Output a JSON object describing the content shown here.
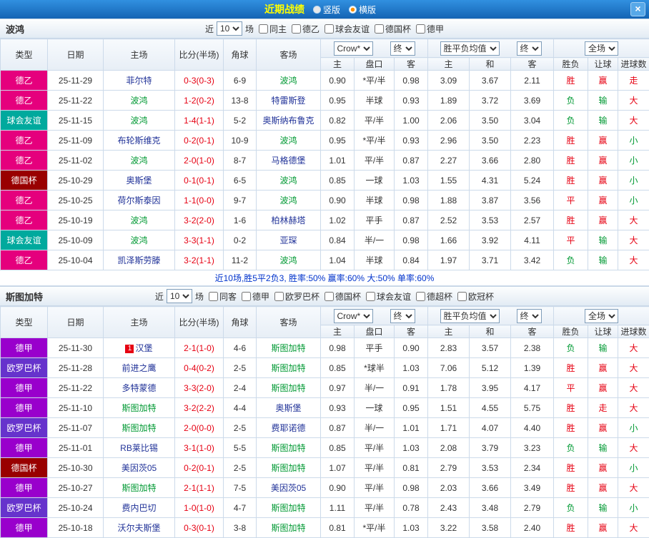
{
  "titlebar": {
    "title": "近期战绩",
    "radio_vertical": "竖版",
    "radio_horizontal": "横版",
    "close_label": "×"
  },
  "controls": {
    "near_label": "近",
    "match_count": "10",
    "games_label": "场",
    "bookmaker": "Crow*",
    "final_label": "终",
    "avg_label": "胜平负均值",
    "scope_label": "全场"
  },
  "columns": {
    "type": "类型",
    "date": "日期",
    "home": "主场",
    "score": "比分(半场)",
    "corners": "角球",
    "away": "客场",
    "odds_home": "主",
    "handicap": "盘口",
    "odds_away": "客",
    "avg_win": "主",
    "avg_draw": "和",
    "avg_lose": "客",
    "result": "胜负",
    "handicap_result": "让球",
    "goals": "进球数"
  },
  "colors": {
    "types": {
      "德乙": "#e5007d",
      "球会友谊": "#00a99d",
      "德国杯": "#990000",
      "德甲": "#9900cc",
      "欧罗巴杯": "#6633cc"
    },
    "focal_team": "#009933",
    "opponent_team": "#203298",
    "score_red": "#e60012",
    "win_red": "#e60012",
    "lose_green": "#009933"
  },
  "teams": [
    {
      "name": "波鸿",
      "checkboxes": [
        "同主",
        "德乙",
        "球会友谊",
        "德国杯",
        "德甲"
      ],
      "summary": "近10场,胜5平2负3, 胜率:50% 赢率:60% 大:50% 单率:60%",
      "matches": [
        {
          "type": "德乙",
          "date": "25-11-29",
          "home": "菲尔特",
          "home_focal": false,
          "score": "0-3(0-3)",
          "corners": "6-9",
          "away": "波鸿",
          "away_focal": true,
          "odds_home": "0.90",
          "handicap": "*平/半",
          "odds_away": "0.98",
          "avg_win": "3.09",
          "avg_draw": "3.67",
          "avg_lose": "2.11",
          "result": "胜",
          "result_color": "red",
          "handicap_result": "赢",
          "handicap_result_color": "red",
          "goals": "走",
          "goals_color": "red"
        },
        {
          "type": "德乙",
          "date": "25-11-22",
          "home": "波鸿",
          "home_focal": true,
          "score": "1-2(0-2)",
          "corners": "13-8",
          "away": "特雷斯登",
          "away_focal": false,
          "odds_home": "0.95",
          "handicap": "半球",
          "odds_away": "0.93",
          "avg_win": "1.89",
          "avg_draw": "3.72",
          "avg_lose": "3.69",
          "result": "负",
          "result_color": "green",
          "handicap_result": "输",
          "handicap_result_color": "green",
          "goals": "大",
          "goals_color": "red"
        },
        {
          "type": "球会友谊",
          "date": "25-11-15",
          "home": "波鸿",
          "home_focal": true,
          "score": "1-4(1-1)",
          "corners": "5-2",
          "away": "奥斯纳布鲁克",
          "away_focal": false,
          "odds_home": "0.82",
          "handicap": "平/半",
          "odds_away": "1.00",
          "avg_win": "2.06",
          "avg_draw": "3.50",
          "avg_lose": "3.04",
          "result": "负",
          "result_color": "green",
          "handicap_result": "输",
          "handicap_result_color": "green",
          "goals": "大",
          "goals_color": "red"
        },
        {
          "type": "德乙",
          "date": "25-11-09",
          "home": "布轮斯维克",
          "home_focal": false,
          "score": "0-2(0-1)",
          "corners": "10-9",
          "away": "波鸿",
          "away_focal": true,
          "odds_home": "0.95",
          "handicap": "*平/半",
          "odds_away": "0.93",
          "avg_win": "2.96",
          "avg_draw": "3.50",
          "avg_lose": "2.23",
          "result": "胜",
          "result_color": "red",
          "handicap_result": "赢",
          "handicap_result_color": "red",
          "goals": "小",
          "goals_color": "green"
        },
        {
          "type": "德乙",
          "date": "25-11-02",
          "home": "波鸿",
          "home_focal": true,
          "score": "2-0(1-0)",
          "corners": "8-7",
          "away": "马格德堡",
          "away_focal": false,
          "odds_home": "1.01",
          "handicap": "平/半",
          "odds_away": "0.87",
          "avg_win": "2.27",
          "avg_draw": "3.66",
          "avg_lose": "2.80",
          "result": "胜",
          "result_color": "red",
          "handicap_result": "赢",
          "handicap_result_color": "red",
          "goals": "小",
          "goals_color": "green"
        },
        {
          "type": "德国杯",
          "date": "25-10-29",
          "home": "奥斯堡",
          "home_focal": false,
          "score": "0-1(0-1)",
          "corners": "6-5",
          "away": "波鸿",
          "away_focal": true,
          "odds_home": "0.85",
          "handicap": "一球",
          "odds_away": "1.03",
          "avg_win": "1.55",
          "avg_draw": "4.31",
          "avg_lose": "5.24",
          "result": "胜",
          "result_color": "red",
          "handicap_result": "赢",
          "handicap_result_color": "red",
          "goals": "小",
          "goals_color": "green"
        },
        {
          "type": "德乙",
          "date": "25-10-25",
          "home": "荷尔斯泰因",
          "home_focal": false,
          "score": "1-1(0-0)",
          "corners": "9-7",
          "away": "波鸿",
          "away_focal": true,
          "odds_home": "0.90",
          "handicap": "半球",
          "odds_away": "0.98",
          "avg_win": "1.88",
          "avg_draw": "3.87",
          "avg_lose": "3.56",
          "result": "平",
          "result_color": "red",
          "handicap_result": "赢",
          "handicap_result_color": "red",
          "goals": "小",
          "goals_color": "green"
        },
        {
          "type": "德乙",
          "date": "25-10-19",
          "home": "波鸿",
          "home_focal": true,
          "score": "3-2(2-0)",
          "corners": "1-6",
          "away": "柏林赫塔",
          "away_focal": false,
          "odds_home": "1.02",
          "handicap": "平手",
          "odds_away": "0.87",
          "avg_win": "2.52",
          "avg_draw": "3.53",
          "avg_lose": "2.57",
          "result": "胜",
          "result_color": "red",
          "handicap_result": "赢",
          "handicap_result_color": "red",
          "goals": "大",
          "goals_color": "red"
        },
        {
          "type": "球会友谊",
          "date": "25-10-09",
          "home": "波鸿",
          "home_focal": true,
          "score": "3-3(1-1)",
          "corners": "0-2",
          "away": "亚琛",
          "away_focal": false,
          "odds_home": "0.84",
          "handicap": "半/一",
          "odds_away": "0.98",
          "avg_win": "1.66",
          "avg_draw": "3.92",
          "avg_lose": "4.11",
          "result": "平",
          "result_color": "red",
          "handicap_result": "输",
          "handicap_result_color": "green",
          "goals": "大",
          "goals_color": "red"
        },
        {
          "type": "德乙",
          "date": "25-10-04",
          "home": "凯泽斯劳滕",
          "home_focal": false,
          "score": "3-2(1-1)",
          "corners": "11-2",
          "away": "波鸿",
          "away_focal": true,
          "odds_home": "1.04",
          "handicap": "半球",
          "odds_away": "0.84",
          "avg_win": "1.97",
          "avg_draw": "3.71",
          "avg_lose": "3.42",
          "result": "负",
          "result_color": "green",
          "handicap_result": "输",
          "handicap_result_color": "green",
          "goals": "大",
          "goals_color": "red"
        }
      ]
    },
    {
      "name": "斯图加特",
      "checkboxes": [
        "同客",
        "德甲",
        "欧罗巴杯",
        "德国杯",
        "球会友谊",
        "德超杯",
        "欧冠杯"
      ],
      "matches": [
        {
          "type": "德甲",
          "date": "25-11-30",
          "home": "汉堡",
          "home_badge": "1",
          "home_focal": false,
          "score": "2-1(1-0)",
          "corners": "4-6",
          "away": "斯图加特",
          "away_focal": true,
          "odds_home": "0.98",
          "handicap": "平手",
          "odds_away": "0.90",
          "avg_win": "2.83",
          "avg_draw": "3.57",
          "avg_lose": "2.38",
          "result": "负",
          "result_color": "green",
          "handicap_result": "输",
          "handicap_result_color": "green",
          "goals": "大",
          "goals_color": "red"
        },
        {
          "type": "欧罗巴杯",
          "date": "25-11-28",
          "home": "前进之鹰",
          "home_focal": false,
          "score": "0-4(0-2)",
          "corners": "2-5",
          "away": "斯图加特",
          "away_focal": true,
          "odds_home": "0.85",
          "handicap": "*球半",
          "odds_away": "1.03",
          "avg_win": "7.06",
          "avg_draw": "5.12",
          "avg_lose": "1.39",
          "result": "胜",
          "result_color": "red",
          "handicap_result": "赢",
          "handicap_result_color": "red",
          "goals": "大",
          "goals_color": "red"
        },
        {
          "type": "德甲",
          "date": "25-11-22",
          "home": "多特蒙德",
          "home_focal": false,
          "score": "3-3(2-0)",
          "corners": "2-4",
          "away": "斯图加特",
          "away_focal": true,
          "odds_home": "0.97",
          "handicap": "半/一",
          "odds_away": "0.91",
          "avg_win": "1.78",
          "avg_draw": "3.95",
          "avg_lose": "4.17",
          "result": "平",
          "result_color": "red",
          "handicap_result": "赢",
          "handicap_result_color": "red",
          "goals": "大",
          "goals_color": "red"
        },
        {
          "type": "德甲",
          "date": "25-11-10",
          "home": "斯图加特",
          "home_focal": true,
          "score": "3-2(2-2)",
          "corners": "4-4",
          "away": "奥斯堡",
          "away_focal": false,
          "odds_home": "0.93",
          "handicap": "一球",
          "odds_away": "0.95",
          "avg_win": "1.51",
          "avg_draw": "4.55",
          "avg_lose": "5.75",
          "result": "胜",
          "result_color": "red",
          "handicap_result": "走",
          "handicap_result_color": "red",
          "goals": "大",
          "goals_color": "red"
        },
        {
          "type": "欧罗巴杯",
          "date": "25-11-07",
          "home": "斯图加特",
          "home_focal": true,
          "score": "2-0(0-0)",
          "corners": "2-5",
          "away": "费耶诺德",
          "away_focal": false,
          "odds_home": "0.87",
          "handicap": "半/一",
          "odds_away": "1.01",
          "avg_win": "1.71",
          "avg_draw": "4.07",
          "avg_lose": "4.40",
          "result": "胜",
          "result_color": "red",
          "handicap_result": "赢",
          "handicap_result_color": "red",
          "goals": "小",
          "goals_color": "green"
        },
        {
          "type": "德甲",
          "date": "25-11-01",
          "home": "RB莱比锡",
          "home_focal": false,
          "score": "3-1(1-0)",
          "corners": "5-5",
          "away": "斯图加特",
          "away_focal": true,
          "odds_home": "0.85",
          "handicap": "平/半",
          "odds_away": "1.03",
          "avg_win": "2.08",
          "avg_draw": "3.79",
          "avg_lose": "3.23",
          "result": "负",
          "result_color": "green",
          "handicap_result": "输",
          "handicap_result_color": "green",
          "goals": "大",
          "goals_color": "red"
        },
        {
          "type": "德国杯",
          "date": "25-10-30",
          "home": "美因茨05",
          "home_focal": false,
          "score": "0-2(0-1)",
          "corners": "2-5",
          "away": "斯图加特",
          "away_focal": true,
          "odds_home": "1.07",
          "handicap": "平/半",
          "odds_away": "0.81",
          "avg_win": "2.79",
          "avg_draw": "3.53",
          "avg_lose": "2.34",
          "result": "胜",
          "result_color": "red",
          "handicap_result": "赢",
          "handicap_result_color": "red",
          "goals": "小",
          "goals_color": "green"
        },
        {
          "type": "德甲",
          "date": "25-10-27",
          "home": "斯图加特",
          "home_focal": true,
          "score": "2-1(1-1)",
          "corners": "7-5",
          "away": "美因茨05",
          "away_focal": false,
          "odds_home": "0.90",
          "handicap": "平/半",
          "odds_away": "0.98",
          "avg_win": "2.03",
          "avg_draw": "3.66",
          "avg_lose": "3.49",
          "result": "胜",
          "result_color": "red",
          "handicap_result": "赢",
          "handicap_result_color": "red",
          "goals": "大",
          "goals_color": "red"
        },
        {
          "type": "欧罗巴杯",
          "date": "25-10-24",
          "home": "费内巴切",
          "home_focal": false,
          "score": "1-0(1-0)",
          "corners": "4-7",
          "away": "斯图加特",
          "away_focal": true,
          "odds_home": "1.11",
          "handicap": "平/半",
          "odds_away": "0.78",
          "avg_win": "2.43",
          "avg_draw": "3.48",
          "avg_lose": "2.79",
          "result": "负",
          "result_color": "green",
          "handicap_result": "输",
          "handicap_result_color": "green",
          "goals": "小",
          "goals_color": "green"
        },
        {
          "type": "德甲",
          "date": "25-10-18",
          "home": "沃尔夫斯堡",
          "home_focal": false,
          "score": "0-3(0-1)",
          "corners": "3-8",
          "away": "斯图加特",
          "away_focal": true,
          "odds_home": "0.81",
          "handicap": "*平/半",
          "odds_away": "1.03",
          "avg_win": "3.22",
          "avg_draw": "3.58",
          "avg_lose": "2.40",
          "result": "胜",
          "result_color": "red",
          "handicap_result": "赢",
          "handicap_result_color": "red",
          "goals": "大",
          "goals_color": "red"
        }
      ]
    }
  ]
}
